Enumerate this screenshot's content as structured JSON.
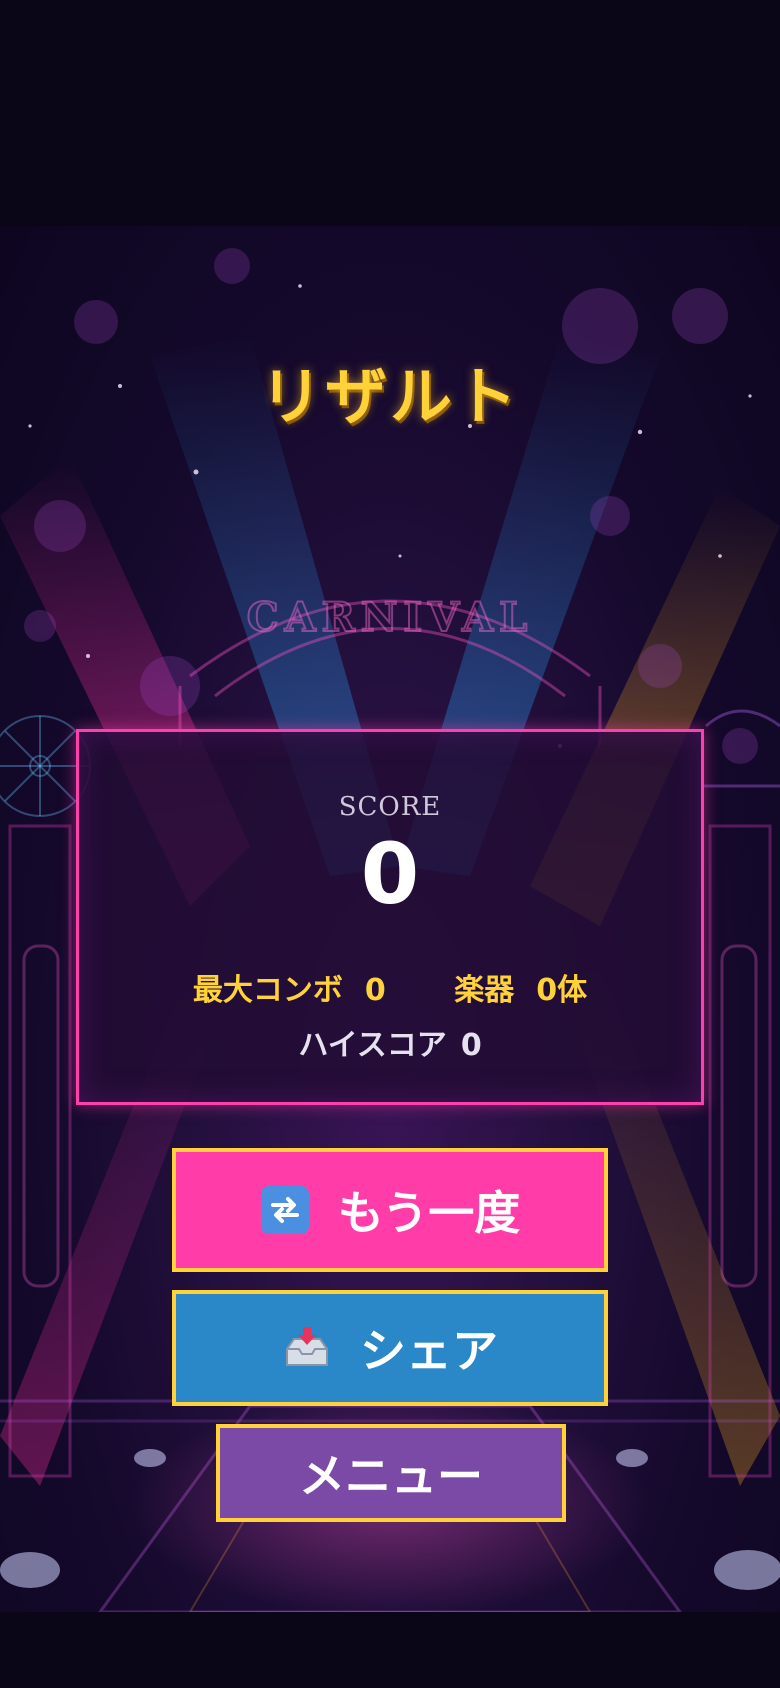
{
  "result": {
    "title": "リザルト",
    "score_label": "SCORE",
    "score_value": "0",
    "max_combo_label": "最大コンボ",
    "max_combo_value": "0",
    "instruments_label": "楽器",
    "instruments_value": "0体",
    "high_score_label": "ハイスコア",
    "high_score_value": "0"
  },
  "background": {
    "sign_text": "CARNIVAL"
  },
  "buttons": {
    "retry_label": "もう一度",
    "retry_icon": "repeat-icon",
    "share_label": "シェア",
    "share_icon": "inbox-tray-icon",
    "menu_label": "メニュー"
  },
  "colors": {
    "title": "#ffd23a",
    "panel_border": "#ff3fae",
    "retry_bg": "#ff3ca8",
    "share_bg": "#2a87c8",
    "menu_bg": "#7b49a6",
    "button_border": "#ffd23a"
  }
}
